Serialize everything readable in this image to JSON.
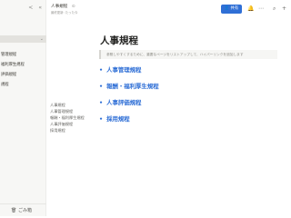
{
  "sidebar": {
    "top_icons": [
      "share-icon",
      "collapse-icon"
    ],
    "items": [
      {
        "label": "",
        "active": false
      },
      {
        "label": "",
        "active": true,
        "chevron": "⌄"
      },
      {
        "label": "管理規程",
        "active": false
      },
      {
        "label": "福利厚生規程",
        "active": false
      },
      {
        "label": "評価規程",
        "active": false
      },
      {
        "label": "規程",
        "active": false
      },
      {
        "label": "",
        "active": false
      }
    ],
    "trash_label": "ごみ箱"
  },
  "header": {
    "title": "人事規程",
    "meta": "最終更新: たった今",
    "share_label": "共有"
  },
  "main": {
    "heading": "人事規程",
    "callout": "参照しやすくするために、重要なページをリストアップして、ハイパーリンクを追加します",
    "toc": [
      "人事規程",
      "人事管理規程",
      "報酬・福利厚生規程",
      "人事評価規程",
      "採用規程"
    ],
    "links": [
      "人事管理規程",
      "報酬・福利厚生規程",
      "人事評価規程",
      "採用規程"
    ]
  },
  "colors": {
    "accent": "#2f6fd6",
    "sidebar_bg": "#f7f7f5"
  }
}
